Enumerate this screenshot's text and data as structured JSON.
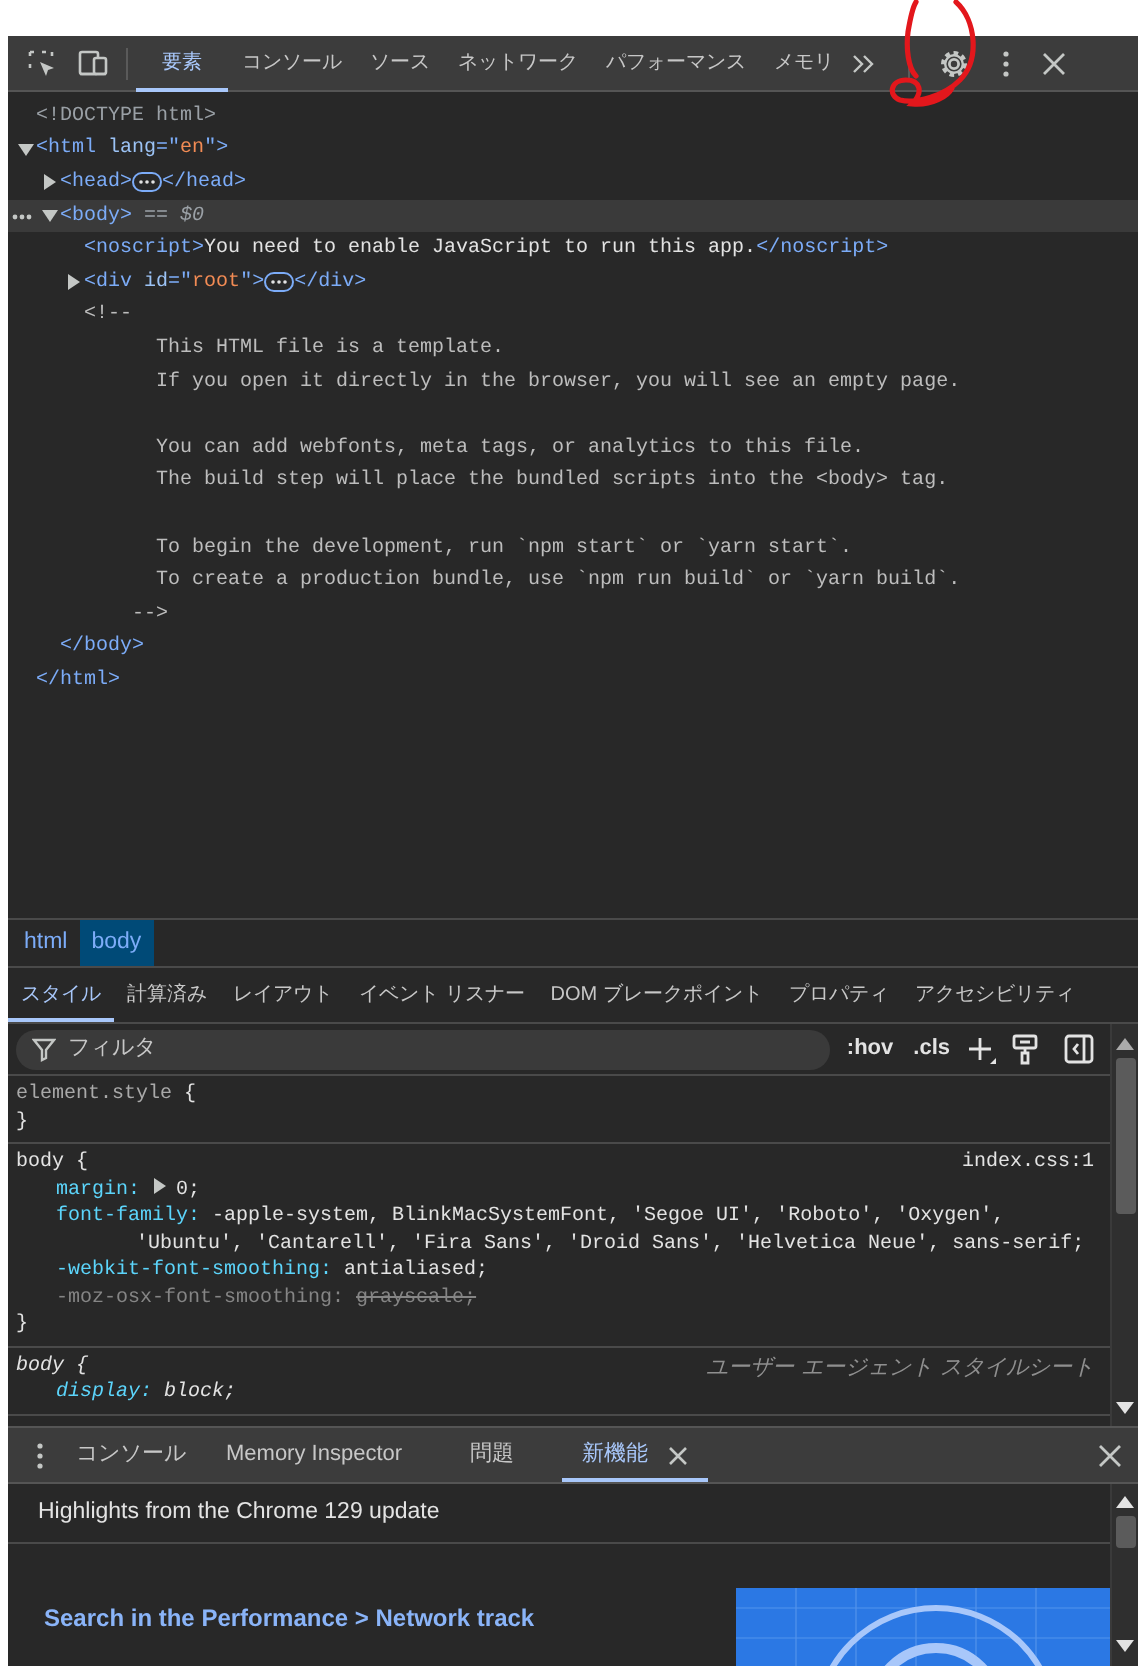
{
  "toolbar": {
    "tabs": [
      {
        "label": "要素",
        "selected": true
      },
      {
        "label": "コンソール",
        "selected": false
      },
      {
        "label": "ソース",
        "selected": false
      },
      {
        "label": "ネットワーク",
        "selected": false
      },
      {
        "label": "パフォーマンス",
        "selected": false
      },
      {
        "label": "メモリ",
        "selected": false
      }
    ]
  },
  "dom_tree": [
    {
      "kind": "doctype",
      "selected": false,
      "text": "<!DOCTYPE html>"
    },
    {
      "kind": "element",
      "selected": false,
      "expanded": true,
      "open": [
        {
          "kind": "tag",
          "text": "<html "
        },
        {
          "kind": "attr",
          "text": "lang"
        },
        {
          "kind": "tag",
          "text": "=\""
        },
        {
          "kind": "value",
          "text": "en"
        },
        {
          "kind": "tag",
          "text": "\">"
        }
      ],
      "children": [
        {
          "kind": "element",
          "selected": false,
          "expanded": false,
          "open": [
            {
              "kind": "tag",
              "text": "<head>"
            }
          ],
          "close": [
            {
              "kind": "tag",
              "text": "</head>"
            }
          ]
        },
        {
          "kind": "element",
          "selected": true,
          "expanded": true,
          "open": [
            {
              "kind": "tag",
              "text": "<body>"
            },
            {
              "kind": "hint",
              "text": " == $0"
            }
          ],
          "children": [
            {
              "kind": "element",
              "selected": false,
              "open": [
                {
                  "kind": "tag",
                  "text": "<noscript>"
                },
                {
                  "kind": "text",
                  "text": "You need to enable JavaScript to run this app."
                },
                {
                  "kind": "tag",
                  "text": "</noscript>"
                }
              ]
            },
            {
              "kind": "element",
              "selected": false,
              "expanded": false,
              "open": [
                {
                  "kind": "tag",
                  "text": "<div "
                },
                {
                  "kind": "attr",
                  "text": "id"
                },
                {
                  "kind": "tag",
                  "text": "=\""
                },
                {
                  "kind": "value",
                  "text": "root"
                },
                {
                  "kind": "tag",
                  "text": "\">"
                }
              ],
              "close": [
                {
                  "kind": "tag",
                  "text": "</div>"
                }
              ]
            },
            {
              "kind": "comment",
              "selected": false,
              "open": "<!--",
              "paragraphs": [
                [
                  "This HTML file is a template.",
                  "If you open it directly in the browser, you will see an empty page."
                ],
                [
                  "You can add webfonts, meta tags, or analytics to this file.",
                  "The build step will place the bundled scripts into the <body> tag."
                ],
                [
                  "To begin the development, run `npm start` or `yarn start`.",
                  "To create a production bundle, use `npm run build` or `yarn build`."
                ]
              ],
              "close": "-->"
            }
          ],
          "close": [
            {
              "kind": "tag",
              "text": "</body>"
            }
          ]
        }
      ],
      "close": [
        {
          "kind": "tag",
          "text": "</html>"
        }
      ]
    }
  ],
  "breadcrumbs": [
    {
      "label": "html",
      "selected": false
    },
    {
      "label": "body",
      "selected": true
    }
  ],
  "panel_tabs": [
    {
      "label": "スタイル",
      "selected": true
    },
    {
      "label": "計算済み",
      "selected": false
    },
    {
      "label": "レイアウト",
      "selected": false
    },
    {
      "label": "イベント リスナー",
      "selected": false
    },
    {
      "label": "DOM ブレークポイント",
      "selected": false
    },
    {
      "label": "プロパティ",
      "selected": false
    },
    {
      "label": "アクセシビリティ",
      "selected": false
    }
  ],
  "styles_toolbar": {
    "filter": {
      "placeholder": "フィルタ"
    },
    "buttons": [
      ":hov",
      ".cls"
    ]
  },
  "rules": [
    {
      "kind": "inline",
      "selector": "element.style",
      "open_brace": "{",
      "close_brace": "}"
    },
    {
      "kind": "author",
      "selector": "body",
      "open_brace": "{",
      "source": "index.css:1",
      "close_brace": "}",
      "declarations": [
        {
          "name": "margin:",
          "expandable": true,
          "value": "0;",
          "overridden": false
        },
        {
          "name": "font-family:",
          "expandable": false,
          "value": "-apple-system, BlinkMacSystemFont, 'Segoe UI', 'Roboto', 'Oxygen', 'Ubuntu', 'Cantarell', 'Fira Sans', 'Droid Sans', 'Helvetica Neue', sans-serif;",
          "overridden": false
        },
        {
          "name": "-webkit-font-smoothing:",
          "expandable": false,
          "value": "antialiased;",
          "overridden": false
        },
        {
          "name": "-moz-osx-font-smoothing:",
          "expandable": false,
          "value": "grayscale;",
          "overridden": true
        }
      ]
    },
    {
      "kind": "user_agent",
      "selector": "body",
      "open_brace": "{",
      "source": "ユーザー エージェント スタイルシート",
      "declarations": [
        {
          "name": "display:",
          "expandable": false,
          "value": "block;",
          "overridden": false
        }
      ]
    }
  ],
  "drawer": {
    "tabs": [
      {
        "label": "コンソール",
        "selected": false,
        "closable": false
      },
      {
        "label": "Memory Inspector",
        "selected": false,
        "closable": false
      },
      {
        "label": "問題",
        "selected": false,
        "closable": false
      },
      {
        "label": "新機能",
        "selected": true,
        "closable": true
      }
    ],
    "heading": "Highlights from the Chrome 129 update",
    "link": "Search in the Performance > Network track"
  }
}
